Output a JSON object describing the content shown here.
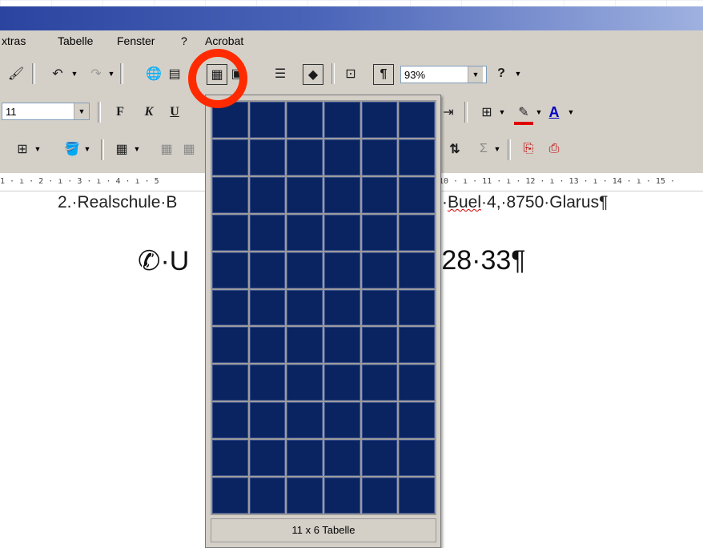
{
  "menu": {
    "items": [
      "xtras",
      "Tabelle",
      "Fenster",
      "?",
      "Acrobat"
    ]
  },
  "toolbar1": {
    "zoom_value": "93%",
    "pilcrow": "¶"
  },
  "toolbar2": {
    "font_size": "11",
    "bold_label": "F",
    "italic_label": "K",
    "underline_label": "U",
    "font_color_label": "A"
  },
  "ruler": {
    "left_text": "1 · ı · 2 · ı · 3 · ı · 4 · ı · 5",
    "right_text": "10 · ı · 11 · ı · 12 · ı · 13 · ı · 14 · ı · 15 ·"
  },
  "document": {
    "line1_left": "2.·Realschule·B",
    "line1_right_pre": "·",
    "line1_right_word": "Buel",
    "line1_right_post": "·4,·8750·Glarus¶",
    "line2_left": "✆·U",
    "line2_right": "·28·33¶"
  },
  "table_grid": {
    "rows": 11,
    "cols": 6,
    "status": "11 x 6 Tabelle"
  },
  "colors": {
    "highlight": "#ff2a00",
    "grid_cell": "#0a2462"
  }
}
